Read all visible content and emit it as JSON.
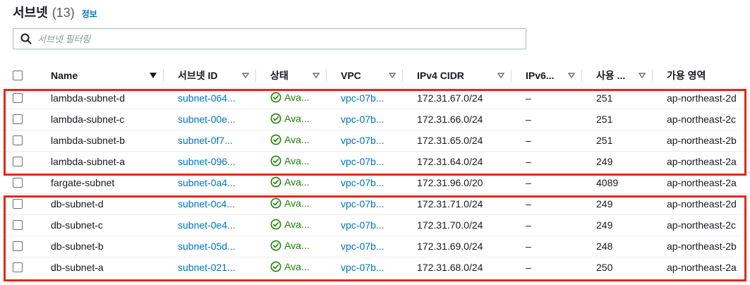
{
  "header": {
    "title": "서브넷",
    "count": "(13)",
    "info_link": "정보"
  },
  "filter": {
    "placeholder": "서브넷 필터링"
  },
  "columns": [
    "Name",
    "서브넷 ID",
    "상태",
    "VPC",
    "IPv4 CIDR",
    "IPv6...",
    "사용 ...",
    "가용 영역"
  ],
  "rows": [
    {
      "name": "lambda-subnet-d",
      "subnet_id": "subnet-064...",
      "status": "Ava...",
      "vpc": "vpc-07b...",
      "ipv4": "172.31.67.0/24",
      "ipv6": "–",
      "available": "251",
      "az": "ap-northeast-2d"
    },
    {
      "name": "lambda-subnet-c",
      "subnet_id": "subnet-00e...",
      "status": "Ava...",
      "vpc": "vpc-07b...",
      "ipv4": "172.31.66.0/24",
      "ipv6": "–",
      "available": "251",
      "az": "ap-northeast-2c"
    },
    {
      "name": "lambda-subnet-b",
      "subnet_id": "subnet-0f7...",
      "status": "Ava...",
      "vpc": "vpc-07b...",
      "ipv4": "172.31.65.0/24",
      "ipv6": "–",
      "available": "251",
      "az": "ap-northeast-2b"
    },
    {
      "name": "lambda-subnet-a",
      "subnet_id": "subnet-096...",
      "status": "Ava...",
      "vpc": "vpc-07b...",
      "ipv4": "172.31.64.0/24",
      "ipv6": "–",
      "available": "249",
      "az": "ap-northeast-2a"
    },
    {
      "name": "fargate-subnet",
      "subnet_id": "subnet-0a4...",
      "status": "Ava...",
      "vpc": "vpc-07b...",
      "ipv4": "172.31.96.0/20",
      "ipv6": "–",
      "available": "4089",
      "az": "ap-northeast-2a"
    },
    {
      "name": "db-subnet-d",
      "subnet_id": "subnet-0c4...",
      "status": "Ava...",
      "vpc": "vpc-07b...",
      "ipv4": "172.31.71.0/24",
      "ipv6": "–",
      "available": "249",
      "az": "ap-northeast-2d"
    },
    {
      "name": "db-subnet-c",
      "subnet_id": "subnet-0e4...",
      "status": "Ava...",
      "vpc": "vpc-07b...",
      "ipv4": "172.31.70.0/24",
      "ipv6": "–",
      "available": "249",
      "az": "ap-northeast-2c"
    },
    {
      "name": "db-subnet-b",
      "subnet_id": "subnet-05d...",
      "status": "Ava...",
      "vpc": "vpc-07b...",
      "ipv4": "172.31.69.0/24",
      "ipv6": "–",
      "available": "248",
      "az": "ap-northeast-2b"
    },
    {
      "name": "db-subnet-a",
      "subnet_id": "subnet-021...",
      "status": "Ava...",
      "vpc": "vpc-07b...",
      "ipv4": "172.31.68.0/24",
      "ipv6": "–",
      "available": "250",
      "az": "ap-northeast-2a"
    }
  ],
  "colors": {
    "link": "#0073bb",
    "status_ok": "#1d8102",
    "highlight": "#e3281b"
  }
}
